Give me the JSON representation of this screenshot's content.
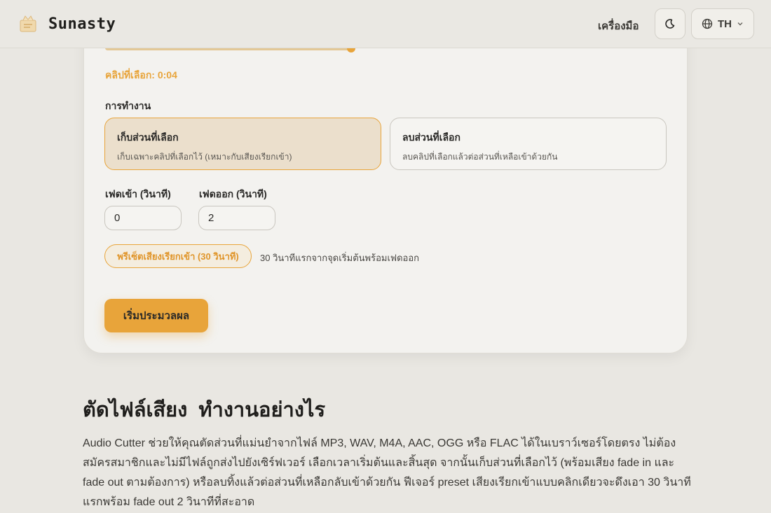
{
  "header": {
    "brand": "Sunasty",
    "nav_tools": "เครื่องมือ",
    "lang": "TH",
    "icons": {
      "logo": "sunasty-logo-icon",
      "theme": "moon-icon",
      "lang": "globe-icon",
      "chevron": "chevron-down-icon"
    }
  },
  "editor": {
    "selected_clip": "คลิปที่เลือก: 0:04",
    "operation_label": "การทำงาน",
    "operations": [
      {
        "title": "เก็บส่วนที่เลือก",
        "desc": "เก็บเฉพาะคลิปที่เลือกไว้ (เหมาะกับเสียงเรียกเข้า)",
        "selected": true
      },
      {
        "title": "ลบส่วนที่เลือก",
        "desc": "ลบคลิปที่เลือกแล้วต่อส่วนที่เหลือเข้าด้วยกัน",
        "selected": false
      }
    ],
    "fade_in_label": "เฟดเข้า (วินาที)",
    "fade_in_value": "0",
    "fade_out_label": "เฟดออก (วินาที)",
    "fade_out_value": "2",
    "preset_label": "พรีเซ็ตเสียงเรียกเข้า (30 วินาที)",
    "preset_note": "30 วินาทีแรกจากจุดเริ่มต้นพร้อมเฟดออก",
    "process_label": "เริ่มประมวลผล"
  },
  "article": {
    "heading": "ตัดไฟล์เสียง ทำงานอย่างไร",
    "body": "Audio Cutter ช่วยให้คุณตัดส่วนที่แม่นยำจากไฟล์ MP3, WAV, M4A, AAC, OGG หรือ FLAC ได้ในเบราว์เซอร์โดยตรง ไม่ต้องสมัครสมาชิกและไม่มีไฟล์ถูกส่งไปยังเซิร์ฟเวอร์ เลือกเวลาเริ่มต้นและสิ้นสุด จากนั้นเก็บส่วนที่เลือกไว้ (พร้อมเสียง fade in และ fade out ตามต้องการ) หรือลบทิ้งแล้วต่อส่วนที่เหลือกลับเข้าด้วยกัน ฟีเจอร์ preset เสียงเรียกเข้าแบบคลิกเดียวจะดึงเอา 30 วินาทีแรกพร้อม fade out 2 วินาทีที่สะอาด"
  },
  "colors": {
    "accent": "#e8a43a",
    "background": "#e9e7e2",
    "card": "#f3f2ef"
  }
}
